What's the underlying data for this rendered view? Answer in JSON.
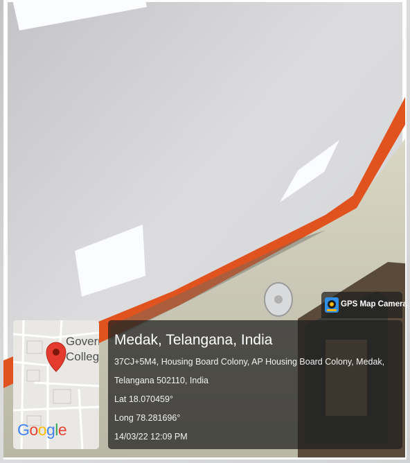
{
  "map": {
    "place_line1": "Govern",
    "place_line2": "College",
    "pin_icon": "map-pin-icon",
    "google_logo": "Google",
    "google_colors": [
      "#4285F4",
      "#EA4335",
      "#FBBC05",
      "#4285F4",
      "#34A853",
      "#EA4335"
    ]
  },
  "badge": {
    "label": "GPS Map Camera",
    "icon": "gps-map-camera-icon"
  },
  "location": {
    "title": "Medak, Telangana, India",
    "address_line1": "37CJ+5M4, Housing Board Colony, AP Housing Board Colony, Medak,",
    "address_line2": "Telangana 502110, India",
    "latitude": "Lat 18.070459°",
    "longitude": "Long 78.281696°",
    "datetime": "14/03/22 12:09 PM"
  }
}
